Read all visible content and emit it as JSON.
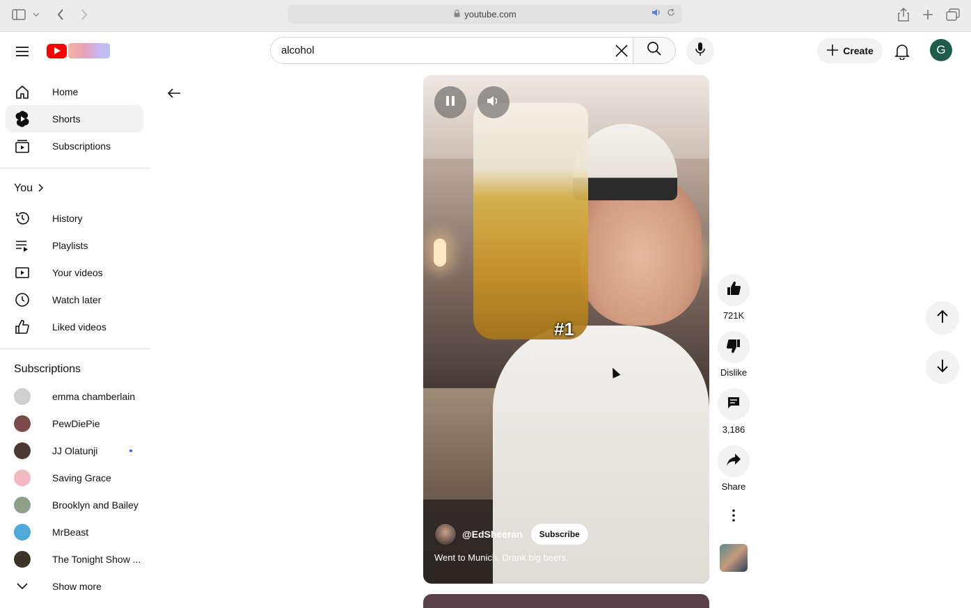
{
  "browser": {
    "url": "youtube.com"
  },
  "header": {
    "search_value": "alcohol",
    "create_label": "Create",
    "avatar_letter": "G"
  },
  "sidebar": {
    "main": [
      {
        "label": "Home",
        "icon": "home-icon"
      },
      {
        "label": "Shorts",
        "icon": "shorts-icon",
        "active": true
      },
      {
        "label": "Subscriptions",
        "icon": "subscriptions-icon"
      }
    ],
    "you_heading": "You",
    "you_items": [
      {
        "label": "History",
        "icon": "history-icon"
      },
      {
        "label": "Playlists",
        "icon": "playlists-icon"
      },
      {
        "label": "Your videos",
        "icon": "your-videos-icon"
      },
      {
        "label": "Watch later",
        "icon": "watch-later-icon"
      },
      {
        "label": "Liked videos",
        "icon": "liked-videos-icon"
      }
    ],
    "subscriptions_heading": "Subscriptions",
    "subscriptions": [
      {
        "name": "emma chamberlain",
        "color": "#cfcfcf"
      },
      {
        "name": "PewDiePie",
        "color": "#7a4a4a"
      },
      {
        "name": "JJ Olatunji",
        "color": "#4a3a35",
        "live": true
      },
      {
        "name": "Saving Grace",
        "color": "#f3b9c1"
      },
      {
        "name": "Brooklyn and Bailey",
        "color": "#8fa089"
      },
      {
        "name": "MrBeast",
        "color": "#4fa8d8"
      },
      {
        "name": "The Tonight Show ...",
        "color": "#3a3326"
      }
    ],
    "show_more": "Show more"
  },
  "short": {
    "overlay_text": "#1",
    "channel": "@EdSheeran",
    "subscribe_label": "Subscribe",
    "caption": "Went to Munich. Drank big beers."
  },
  "actions": {
    "likes": "721K",
    "dislike_label": "Dislike",
    "comments": "3,186",
    "share_label": "Share"
  }
}
